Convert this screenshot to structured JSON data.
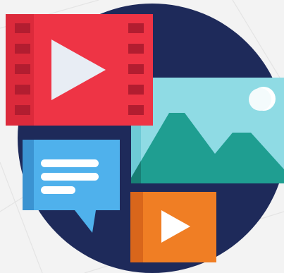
{
  "colors": {
    "background": "#f3f3f3",
    "background_lines": "#e4e4e4",
    "circle": "#1e2a5a",
    "video_red": "#ee3445",
    "video_red_side": "#c92436",
    "film_hole": "#b21d30",
    "play_icon": "#e8edf4",
    "photo_frame": "#8fdbe4",
    "photo_frame_shade": "#6ecad6",
    "mountain": "#1f9e91",
    "sun": "#ffffff",
    "chat_blue": "#4fb1ec",
    "chat_blue_side": "#3b93d1",
    "chat_lines": "#ffffff",
    "video_orange": "#f07e24",
    "video_orange_side": "#d9661b"
  },
  "icons": [
    "film-video-icon",
    "play-icon",
    "image-icon",
    "mountain-icon",
    "sun-icon",
    "chat-bubble-icon",
    "orange-video-icon"
  ]
}
